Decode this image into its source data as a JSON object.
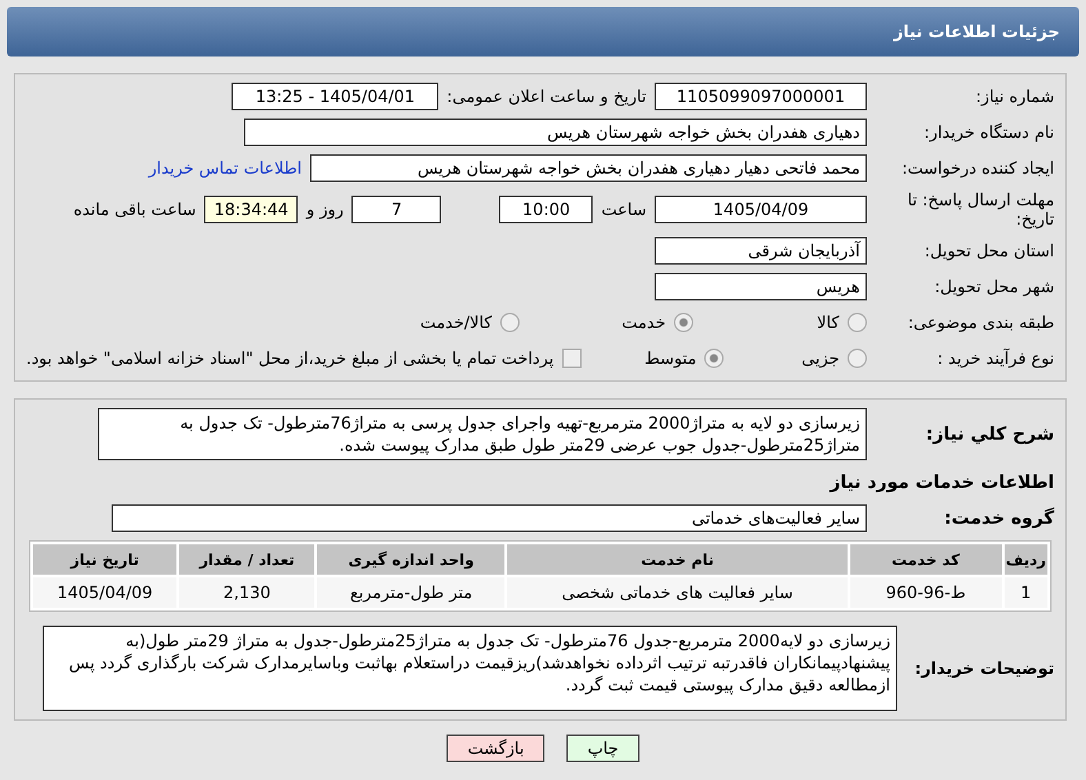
{
  "header": {
    "title": "جزئیات اطلاعات نیاز"
  },
  "need_number": {
    "label": "شماره نیاز:",
    "value": "1105099097000001"
  },
  "announce": {
    "label": "تاریخ و ساعت اعلان عمومی:",
    "value": "1405/04/01 - 13:25"
  },
  "buyer_org": {
    "label": "نام دستگاه خریدار:",
    "value": "دهیاری هفدران بخش خواجه شهرستان هریس"
  },
  "creator": {
    "label": "ایجاد کننده درخواست:",
    "value": "محمد فاتحی دهیار دهیاری هفدران بخش خواجه شهرستان هریس",
    "link": "اطلاعات تماس خریدار"
  },
  "deadline": {
    "label": "مهلت ارسال پاسخ: تا تاریخ:",
    "date": "1405/04/09",
    "time_label": "ساعت",
    "time": "10:00",
    "days": "7",
    "days_label": "روز و",
    "remaining": "18:34:44",
    "remaining_label": "ساعت باقی مانده"
  },
  "province": {
    "label": "استان محل تحویل:",
    "value": "آذربایجان شرقی"
  },
  "city": {
    "label": "شهر محل تحویل:",
    "value": "هریس"
  },
  "classification": {
    "label": "طبقه بندی موضوعی:",
    "options": [
      {
        "label": "کالا",
        "selected": false
      },
      {
        "label": "خدمت",
        "selected": true
      },
      {
        "label": "کالا/خدمت",
        "selected": false
      }
    ]
  },
  "process": {
    "label": "نوع فرآیند خرید :",
    "options": [
      {
        "label": "جزیی",
        "selected": false
      },
      {
        "label": "متوسط",
        "selected": true
      }
    ],
    "payment": {
      "checked": false,
      "label": "پرداخت تمام یا بخشی از مبلغ خرید،از محل \"اسناد خزانه اسلامی\" خواهد بود."
    }
  },
  "description": {
    "label": "شرح کلي نياز:",
    "value": "زیرسازی دو لایه به متراژ2000 مترمربع-تهیه واجرای جدول پرسی به متراژ76مترطول- تک جدول به متراژ25مترطول-جدول جوب عرضی 29متر طول طبق مدارک پیوست شده."
  },
  "services_heading": "اطلاعات خدمات مورد نياز",
  "service_group": {
    "label": "گروه خدمت:",
    "value": "سایر فعالیت‌های خدماتی"
  },
  "table": {
    "columns": [
      "ردیف",
      "کد خدمت",
      "نام خدمت",
      "واحد اندازه گیری",
      "تعداد / مقدار",
      "تاریخ نیاز"
    ],
    "rows": [
      [
        "1",
        "ط-96-960",
        "سایر فعالیت های خدماتی شخصی",
        "متر طول-مترمربع",
        "2,130",
        "1405/04/09"
      ]
    ]
  },
  "buyer_notes": {
    "label": "توضیحات خریدار:",
    "value": "زیرسازی دو لایه2000 مترمربع-جدول 76مترطول- تک جدول به متراژ25مترطول-جدول به متراژ 29متر طول(به پیشنهادپیمانکاران فاقدرتبه ترتیب اثرداده نخواهدشد)ریزقیمت دراستعلام بهاثبت وباسایرمدارک شرکت بارگذاری گردد پس ازمطالعه دقیق مدارک پیوستی قیمت ثبت گردد."
  },
  "buttons": [
    {
      "kind": "print",
      "label": "چاپ"
    },
    {
      "kind": "back",
      "label": "بازگشت"
    }
  ]
}
